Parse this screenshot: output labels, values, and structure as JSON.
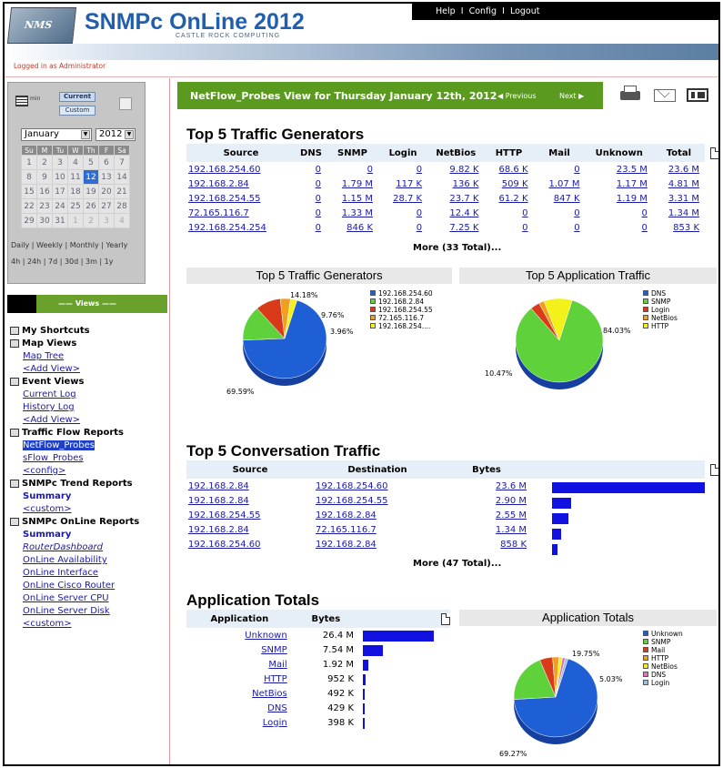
{
  "header": {
    "logo_text": "NMS",
    "title": "SNMPc OnLine 2012",
    "subtitle": "CASTLE ROCK COMPUTING",
    "top_links": [
      "Help",
      "Config",
      "Logout"
    ],
    "logged_in": "Logged in as Administrator"
  },
  "calendar": {
    "view_buttons": [
      "Current",
      "Custom"
    ],
    "min_label": "min",
    "month": "January",
    "year": "2012",
    "day_headers": [
      "Su",
      "M",
      "Tu",
      "W",
      "Th",
      "F",
      "Sa"
    ],
    "weeks": [
      [
        "1",
        "2",
        "3",
        "4",
        "5",
        "6",
        "7"
      ],
      [
        "8",
        "9",
        "10",
        "11",
        "12",
        "13",
        "14"
      ],
      [
        "15",
        "16",
        "17",
        "18",
        "19",
        "20",
        "21"
      ],
      [
        "22",
        "23",
        "24",
        "25",
        "26",
        "27",
        "28"
      ],
      [
        "29",
        "30",
        "31",
        "1",
        "2",
        "3",
        "4"
      ]
    ],
    "today": "12",
    "periods": [
      "Daily",
      "Weekly",
      "Monthly",
      "Yearly"
    ],
    "ranges": [
      "4h",
      "24h",
      "7d",
      "30d",
      "3m",
      "1y"
    ]
  },
  "sidebar": {
    "views_label": "Views",
    "sections": [
      {
        "title": "My Shortcuts",
        "items": []
      },
      {
        "title": "Map Views",
        "items": [
          {
            "label": "Map Tree",
            "style": "link"
          },
          {
            "label": "<Add View>",
            "style": "link"
          }
        ]
      },
      {
        "title": "Event Views",
        "items": [
          {
            "label": "Current Log",
            "style": "link"
          },
          {
            "label": "History Log",
            "style": "link"
          },
          {
            "label": "<Add View>",
            "style": "link"
          }
        ]
      },
      {
        "title": "Traffic Flow Reports",
        "items": [
          {
            "label": "NetFlow_Probes",
            "style": "sel"
          },
          {
            "label": "sFlow_Probes",
            "style": "link"
          },
          {
            "label": "<config>",
            "style": "link"
          }
        ]
      },
      {
        "title": "SNMPc Trend Reports",
        "items": [
          {
            "label": "Summary",
            "style": "bold"
          },
          {
            "label": "<custom>",
            "style": "link"
          }
        ]
      },
      {
        "title": "SNMPc OnLine Reports",
        "items": [
          {
            "label": "Summary",
            "style": "bold"
          },
          {
            "label": "RouterDashboard",
            "style": "ital"
          },
          {
            "label": "OnLine Availability",
            "style": "link"
          },
          {
            "label": "OnLine Interface",
            "style": "link"
          },
          {
            "label": "OnLine Cisco Router",
            "style": "link"
          },
          {
            "label": "OnLine Server CPU",
            "style": "link"
          },
          {
            "label": "OnLine Server Disk",
            "style": "link"
          },
          {
            "label": "<custom>",
            "style": "link"
          }
        ]
      }
    ]
  },
  "view_header": {
    "title": "NetFlow_Probes View for Thursday January 12th, 2012",
    "previous": "◀ Previous",
    "next": "Next ▶"
  },
  "traffic_generators": {
    "title": "Top 5 Traffic Generators",
    "columns": [
      "Source",
      "DNS",
      "SNMP",
      "Login",
      "NetBios",
      "HTTP",
      "Mail",
      "Unknown",
      "Total"
    ],
    "rows": [
      [
        "192.168.254.60",
        "0",
        "0",
        "0",
        "9.82 K",
        "68.6 K",
        "0",
        "23.5 M",
        "23.6 M"
      ],
      [
        "192.168.2.84",
        "0",
        "1.79 M",
        "117 K",
        "136 K",
        "509 K",
        "1.07 M",
        "1.17 M",
        "4.81 M"
      ],
      [
        "192.168.254.55",
        "0",
        "1.15 M",
        "28.7 K",
        "23.7 K",
        "61.2 K",
        "847 K",
        "1.19 M",
        "3.31 M"
      ],
      [
        "72.165.116.7",
        "0",
        "1.33 M",
        "0",
        "12.4 K",
        "0",
        "0",
        "0",
        "1.34 M"
      ],
      [
        "192.168.254.254",
        "0",
        "846 K",
        "0",
        "7.25 K",
        "0",
        "0",
        "0",
        "853 K"
      ]
    ],
    "more": "More (33 Total)..."
  },
  "pie_generators": {
    "title": "Top 5 Traffic Generators",
    "legend": [
      {
        "label": "192.168.254.60",
        "color": "#1f5fd6"
      },
      {
        "label": "192.168.2.84",
        "color": "#5fd13a"
      },
      {
        "label": "192.168.254.55",
        "color": "#d93a1a"
      },
      {
        "label": "72.165.116.7",
        "color": "#f0a020"
      },
      {
        "label": "192.168.254....",
        "color": "#f2f21a"
      }
    ],
    "slices": [
      69.59,
      14.18,
      9.76,
      3.96,
      2.51
    ],
    "labels": [
      "69.59%",
      "14.18%",
      "9.76%",
      "3.96%"
    ]
  },
  "pie_apps": {
    "title": "Top 5 Application Traffic",
    "legend": [
      {
        "label": "DNS",
        "color": "#1f5fd6"
      },
      {
        "label": "SNMP",
        "color": "#5fd13a"
      },
      {
        "label": "Login",
        "color": "#d93a1a"
      },
      {
        "label": "NetBios",
        "color": "#f0a020"
      },
      {
        "label": "HTTP",
        "color": "#f2f21a"
      }
    ],
    "slices": [
      0,
      84.03,
      3.5,
      2,
      10.47
    ],
    "labels": [
      "84.03%",
      "10.47%"
    ]
  },
  "conversations": {
    "title": "Top 5 Conversation Traffic",
    "columns": [
      "Source",
      "Destination",
      "Bytes"
    ],
    "rows": [
      {
        "src": "192.168.2.84",
        "dst": "192.168.254.60",
        "bytes": "23.6 M",
        "frac": 1.0
      },
      {
        "src": "192.168.2.84",
        "dst": "192.168.254.55",
        "bytes": "2.90 M",
        "frac": 0.123
      },
      {
        "src": "192.168.254.55",
        "dst": "192.168.2.84",
        "bytes": "2.55 M",
        "frac": 0.108
      },
      {
        "src": "192.168.2.84",
        "dst": "72.165.116.7",
        "bytes": "1.34 M",
        "frac": 0.057
      },
      {
        "src": "192.168.254.60",
        "dst": "192.168.2.84",
        "bytes": "858 K",
        "frac": 0.036
      }
    ],
    "more": "More (47 Total)..."
  },
  "app_totals": {
    "title": "Application Totals",
    "columns": [
      "Application",
      "Bytes"
    ],
    "rows": [
      {
        "app": "Unknown",
        "bytes": "26.4 M",
        "frac": 1.0
      },
      {
        "app": "SNMP",
        "bytes": "7.54 M",
        "frac": 0.286
      },
      {
        "app": "Mail",
        "bytes": "1.92 M",
        "frac": 0.073
      },
      {
        "app": "HTTP",
        "bytes": "952 K",
        "frac": 0.036
      },
      {
        "app": "NetBios",
        "bytes": "492 K",
        "frac": 0.019
      },
      {
        "app": "DNS",
        "bytes": "429 K",
        "frac": 0.016
      },
      {
        "app": "Login",
        "bytes": "398 K",
        "frac": 0.015
      }
    ]
  },
  "pie_totals": {
    "title": "Application Totals",
    "legend": [
      {
        "label": "Unknown",
        "color": "#1f5fd6"
      },
      {
        "label": "SNMP",
        "color": "#5fd13a"
      },
      {
        "label": "Mail",
        "color": "#d93a1a"
      },
      {
        "label": "HTTP",
        "color": "#f0a020"
      },
      {
        "label": "NetBios",
        "color": "#f2f21a"
      },
      {
        "label": "DNS",
        "color": "#e070c0"
      },
      {
        "label": "Login",
        "color": "#a0c0e0"
      }
    ],
    "slices": [
      69.27,
      19.75,
      5.03,
      2.5,
      1.3,
      1.1,
      1.05
    ],
    "labels": [
      "69.27%",
      "19.75%",
      "5.03%"
    ]
  }
}
